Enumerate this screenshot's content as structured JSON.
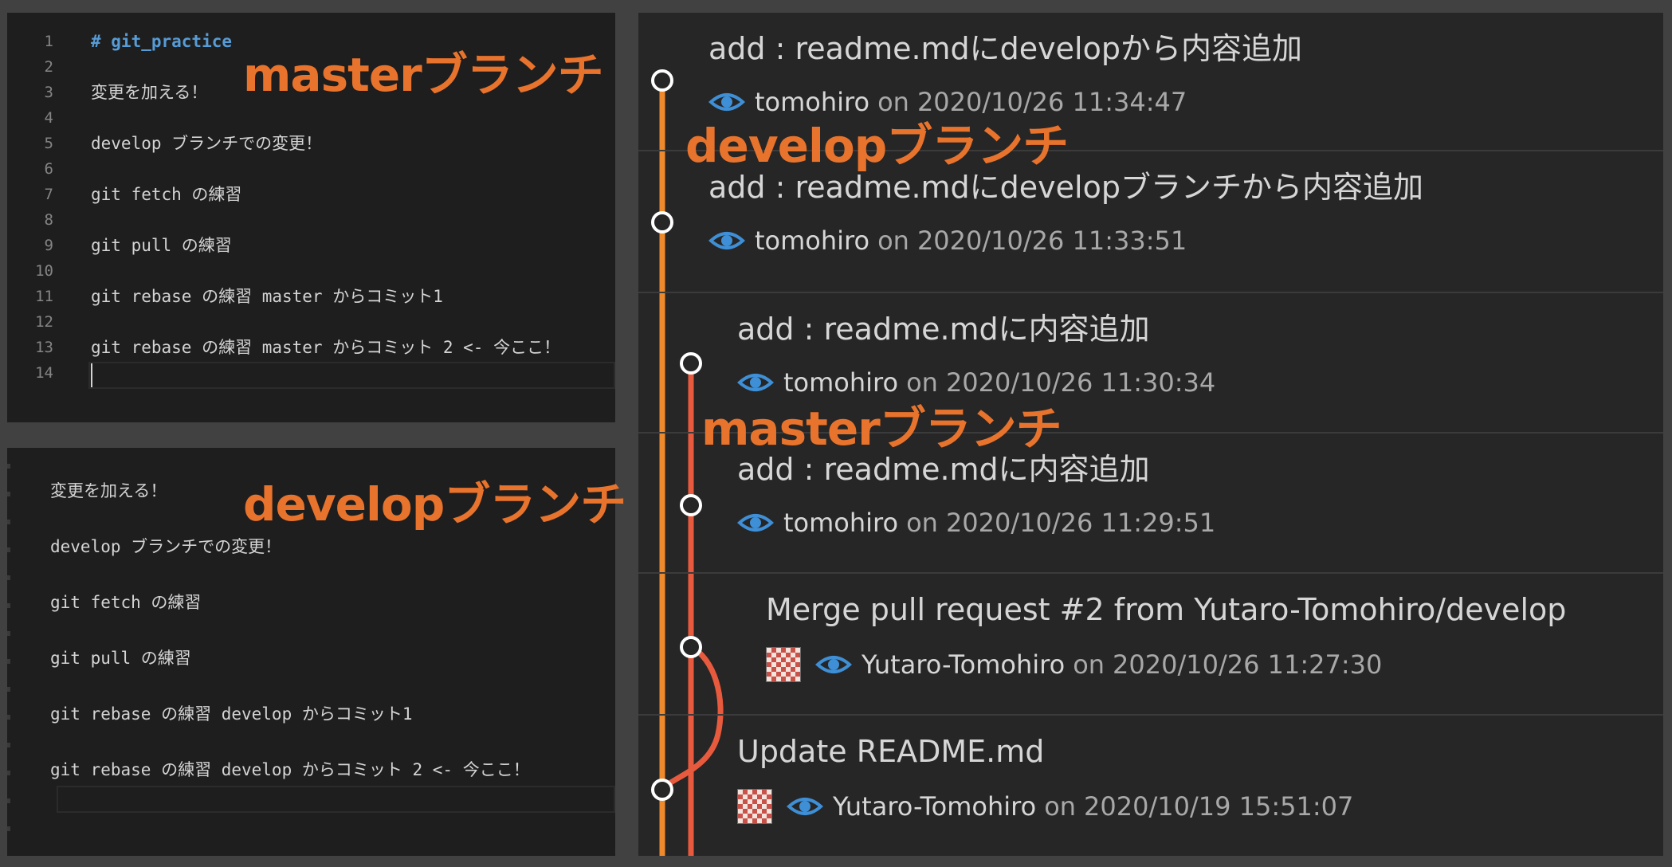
{
  "editor_top": {
    "lines": [
      {
        "num": "1",
        "text": "# git_practice",
        "heading": true
      },
      {
        "num": "2",
        "text": ""
      },
      {
        "num": "3",
        "text": "変更を加える！"
      },
      {
        "num": "4",
        "text": ""
      },
      {
        "num": "5",
        "text": "develop ブランチでの変更！"
      },
      {
        "num": "6",
        "text": ""
      },
      {
        "num": "7",
        "text": "git fetch の練習"
      },
      {
        "num": "8",
        "text": ""
      },
      {
        "num": "9",
        "text": "git pull の練習"
      },
      {
        "num": "10",
        "text": ""
      },
      {
        "num": "11",
        "text": "git rebase の練習 master からコミット1"
      },
      {
        "num": "12",
        "text": ""
      },
      {
        "num": "13",
        "text": "git rebase の練習 master からコミット 2 <- 今ここ！"
      },
      {
        "num": "14",
        "text": ""
      }
    ],
    "annotation": "masterブランチ"
  },
  "editor_bottom": {
    "lines": [
      "変更を加える！",
      "develop ブランチでの変更！",
      "git fetch の練習",
      "git pull の練習",
      "git rebase の練習 develop からコミット1",
      "git rebase の練習 develop からコミット 2 <- 今ここ！"
    ],
    "annotation": "developブランチ"
  },
  "git_log": {
    "annotations": [
      "developブランチ",
      "masterブランチ"
    ],
    "commits": [
      {
        "message": "add : readme.mdにdevelopから内容追加",
        "author": "tomohiro",
        "on": "on",
        "date": "2020/10/26 11:34:47",
        "avatar": false
      },
      {
        "message": "add : readme.mdにdevelopブランチから内容追加",
        "author": "tomohiro",
        "on": "on",
        "date": "2020/10/26 11:33:51",
        "avatar": false
      },
      {
        "message": "add : readme.mdに内容追加",
        "author": "tomohiro",
        "on": "on",
        "date": "2020/10/26 11:30:34",
        "avatar": false
      },
      {
        "message": "add : readme.mdに内容追加",
        "author": "tomohiro",
        "on": "on",
        "date": "2020/10/26 11:29:51",
        "avatar": false
      },
      {
        "message": "Merge pull request #2 from Yutaro-Tomohiro/develop",
        "author": "Yutaro-Tomohiro",
        "on": "on",
        "date": "2020/10/26 11:27:30",
        "avatar": true
      },
      {
        "message": "Update README.md",
        "author": "Yutaro-Tomohiro",
        "on": "on",
        "date": "2020/10/19 15:51:07",
        "avatar": true
      }
    ]
  },
  "colors": {
    "develop_line": "#ef8a2c",
    "master_line": "#e85a3d",
    "annotation": "#e8732c",
    "eye_icon": "#3f8fd6"
  }
}
